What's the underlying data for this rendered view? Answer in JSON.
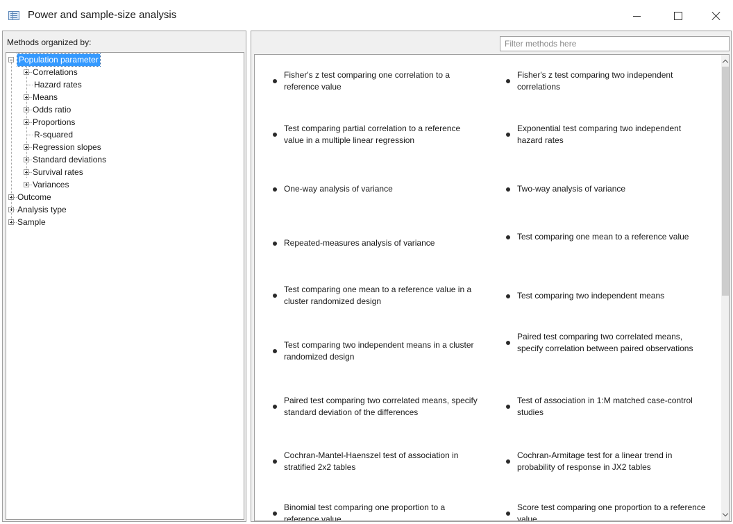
{
  "window": {
    "title": "Power and sample-size analysis",
    "icon": "table-window-icon",
    "controls": [
      "minimize-icon",
      "maximize-icon",
      "close-icon"
    ]
  },
  "sidebar": {
    "header": "Methods organized by:",
    "tree": {
      "root": "Population parameter",
      "children": [
        "Correlations",
        "Hazard rates",
        "Means",
        "Odds ratio",
        "Proportions",
        "R-squared",
        "Regression slopes",
        "Standard deviations",
        "Survival rates",
        "Variances"
      ],
      "other_roots": [
        "Outcome",
        "Analysis type",
        "Sample"
      ]
    }
  },
  "search": {
    "placeholder": "Filter methods here",
    "value": ""
  },
  "methods": {
    "left": [
      "Fisher's z test comparing one correlation to a reference value",
      "Test comparing partial correlation to a reference value in a multiple linear regression",
      "One-way analysis of variance",
      "Repeated-measures analysis of variance",
      "Test comparing one mean to a reference value in a cluster randomized design",
      "Test comparing two independent means in a cluster randomized design",
      "Paired test comparing two correlated means, specify standard deviation of the differences",
      "Cochran-Mantel-Haenszel test of association in stratified 2x2 tables",
      "Binomial test comparing one proportion to a reference value"
    ],
    "right": [
      "Fisher's z test comparing two independent correlations",
      "Exponential test comparing two independent hazard rates",
      "Two-way analysis of variance",
      "Test comparing one mean to a reference value",
      "Test comparing two independent means",
      "Paired test comparing two correlated means, specify correlation between paired observations",
      "Test of association in 1:M matched case-control studies",
      "Cochran-Armitage test for a linear trend in probability of response in JX2 tables",
      "Score test comparing one proportion to a reference value"
    ]
  },
  "colors": {
    "selection": "#3399ff",
    "panel_bg": "#f0f0f0"
  }
}
